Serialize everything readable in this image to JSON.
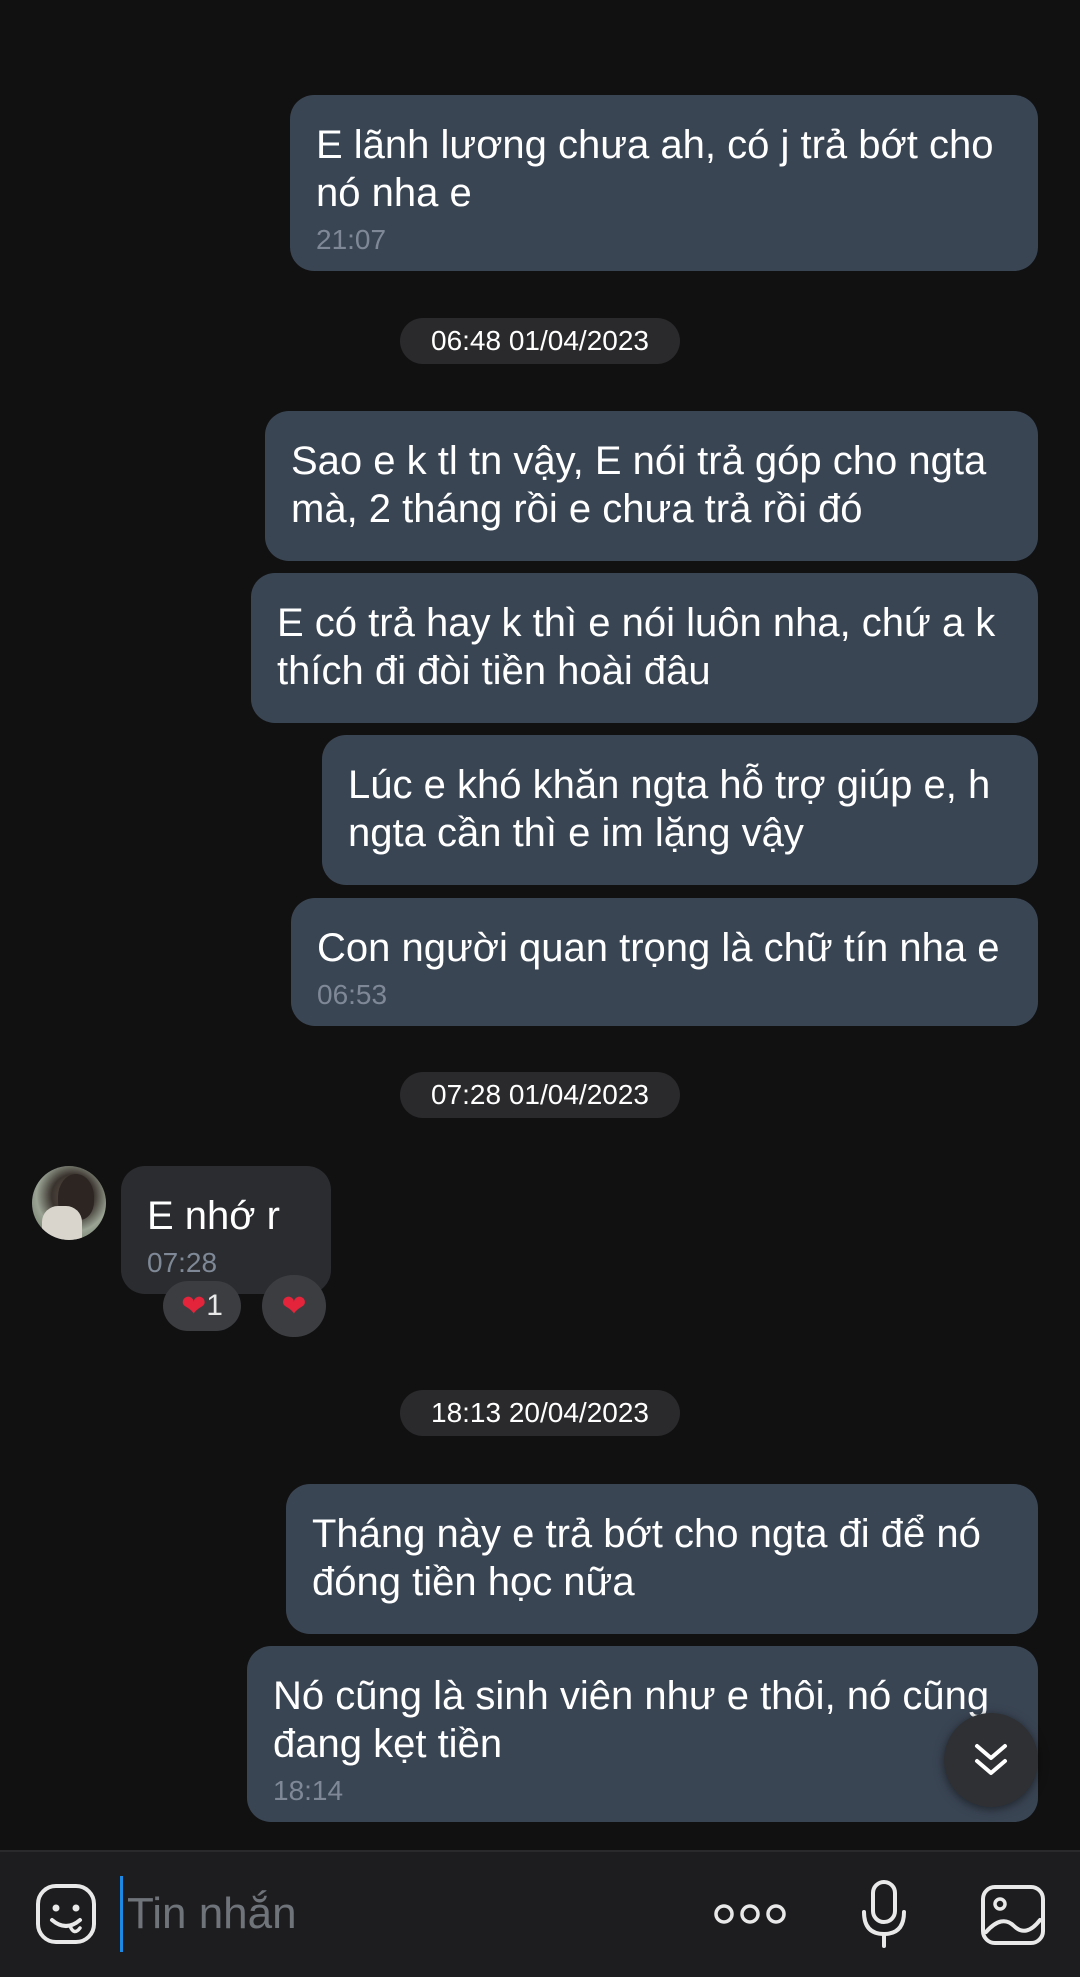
{
  "messages": [
    {
      "id": "m1",
      "text": "E lãnh lương chưa ah, có j trả bớt cho nó nha e",
      "time": "21:07"
    },
    {
      "id": "m2",
      "text": "Sao e k tl tn vậy, E nói trả góp cho ngta mà, 2 tháng rồi e chưa trả rồi đó"
    },
    {
      "id": "m3",
      "text": "E có trả hay k thì e nói luôn nha, chứ a k thích đi đòi tiền hoài đâu"
    },
    {
      "id": "m4",
      "text": "Lúc e khó khăn ngta hỗ trợ giúp e, h ngta cần thì e im lặng vậy"
    },
    {
      "id": "m5",
      "text": "Con người quan trọng là chữ tín nha e",
      "time": "06:53"
    },
    {
      "id": "m6",
      "text": "E nhớ r",
      "time": "07:28"
    },
    {
      "id": "m7",
      "text": "Tháng này e trả bớt cho ngta đi để nó đóng tiền học nữa"
    },
    {
      "id": "m8",
      "text": "Nó cũng là sinh viên như e thôi, nó cũng đang kẹt tiền",
      "time": "18:14"
    }
  ],
  "date_separators": [
    "06:48 01/04/2023",
    "07:28 01/04/2023",
    "18:13 20/04/2023"
  ],
  "reactions": {
    "heart_count": "1",
    "heart_icon": "❤️"
  },
  "composer": {
    "placeholder": "Tin nhắn"
  },
  "icons": [
    "sticker-icon",
    "more-icon",
    "microphone-icon",
    "image-icon",
    "scroll-down-icon",
    "heart-icon"
  ],
  "colors": {
    "background": "#111112",
    "sent_bubble": "#3a4554",
    "received_bubble": "#2b2c2f",
    "date_pill": "#2a2a2c",
    "cursor": "#1e88e5",
    "heart": "#e3243b"
  }
}
